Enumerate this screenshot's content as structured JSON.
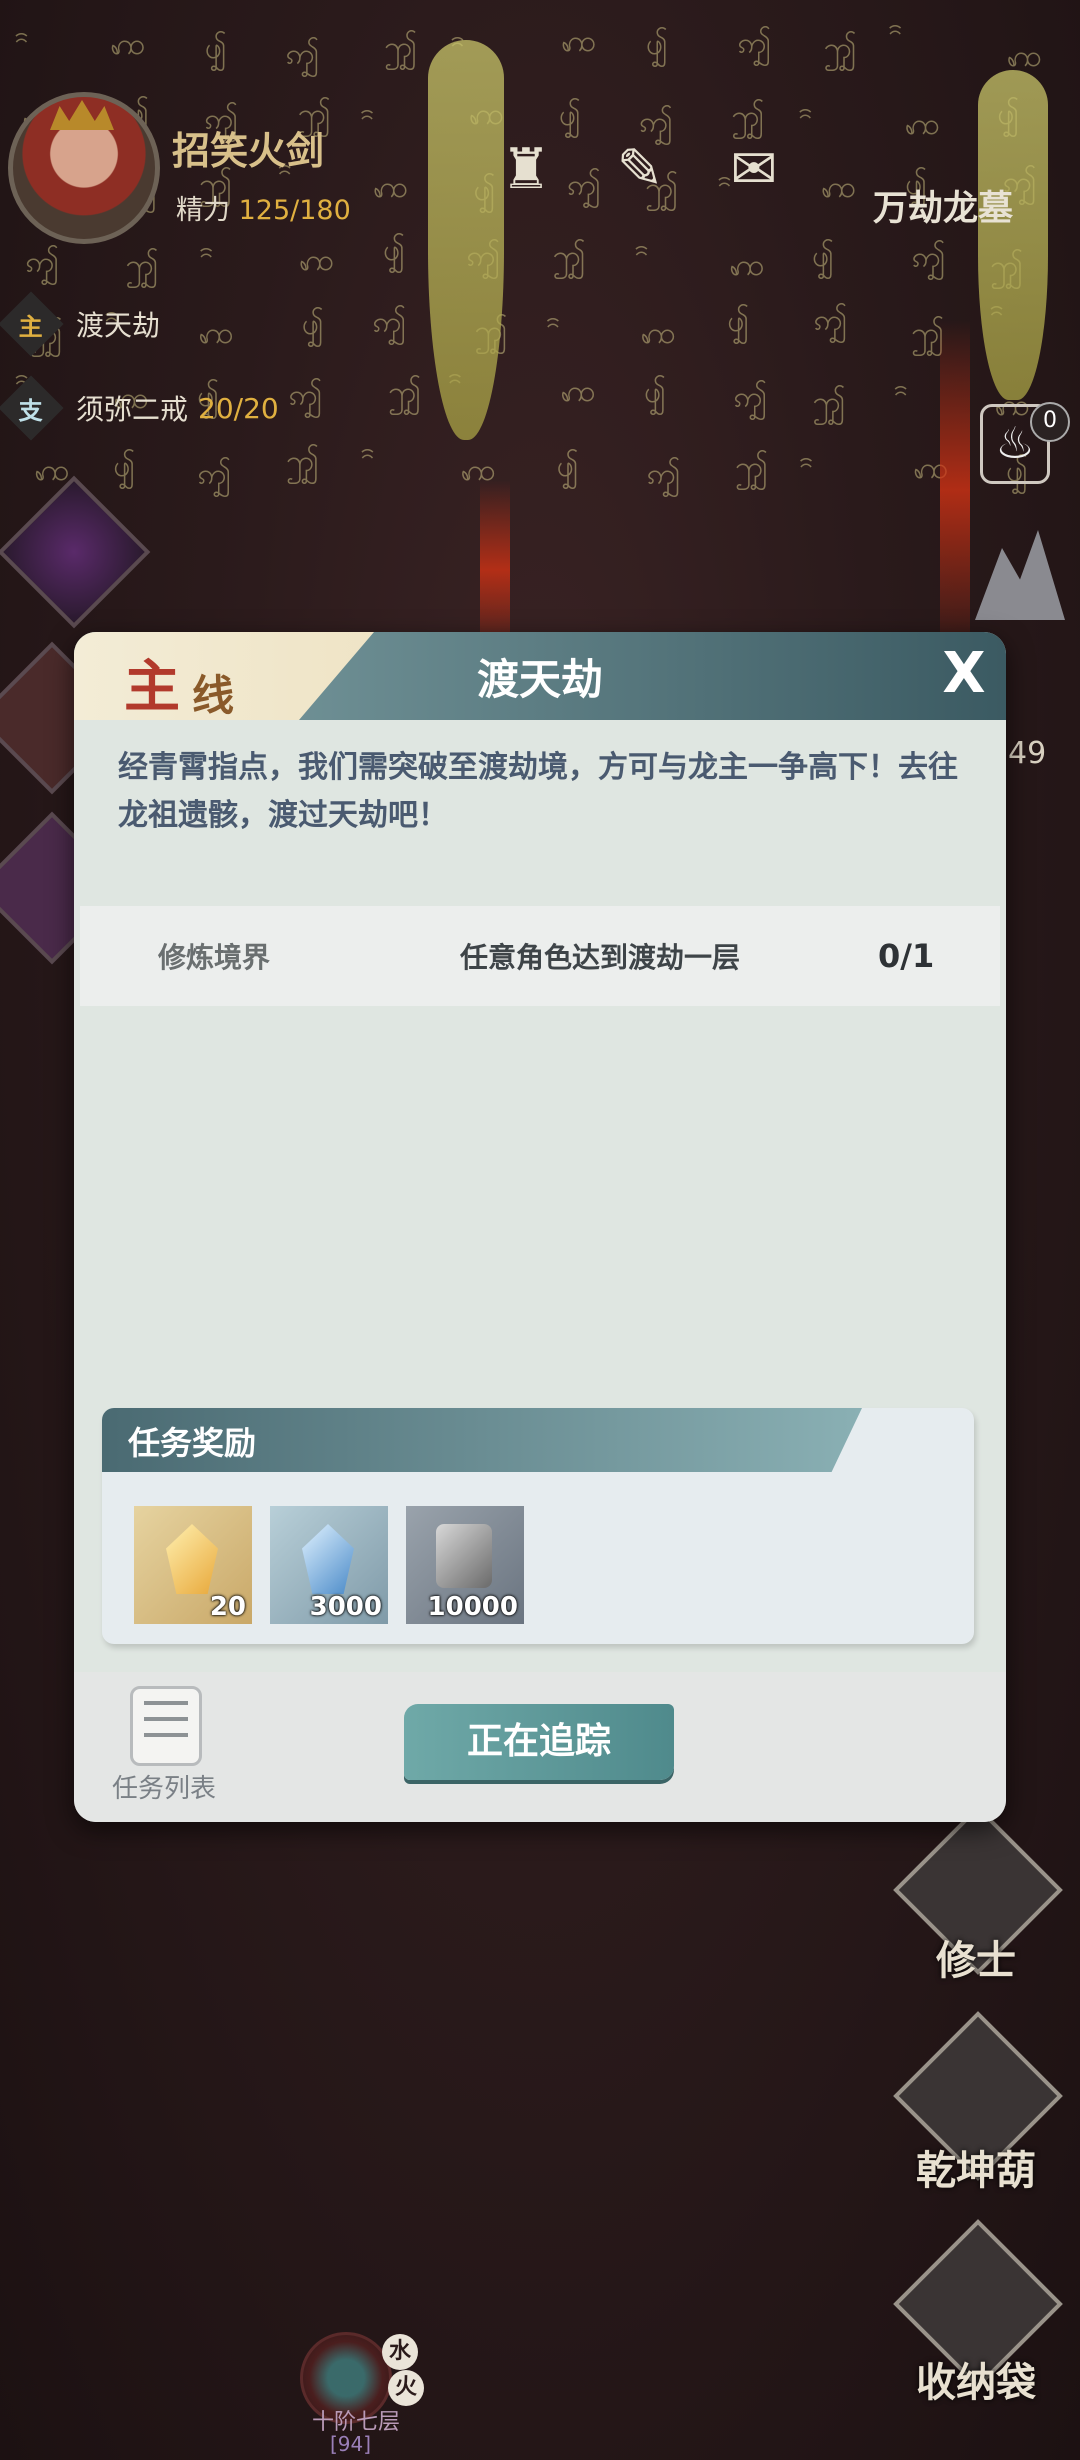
{
  "header": {
    "player_name": "招笑火剑",
    "energy_label": "精力",
    "energy_value": "125/180",
    "location": "万劫龙墓",
    "top_icons": [
      "bell-tower-icon",
      "scroll-map-icon",
      "scroll-bundle-icon"
    ]
  },
  "quests": [
    {
      "tag": "主",
      "name": "渡天劫",
      "progress": ""
    },
    {
      "tag": "支",
      "name": "须弥二戒",
      "progress": "20/20"
    }
  ],
  "right_side": {
    "badge_count": "0",
    "partial_number": "49",
    "buttons": [
      {
        "label": "修士",
        "icon": "cultivator-icon"
      },
      {
        "label": "乾坤葫",
        "icon": "gourd-icon"
      },
      {
        "label": "收纳袋",
        "icon": "storage-bag-icon"
      }
    ]
  },
  "dialog": {
    "tab_main": "主",
    "tab_line": "线",
    "title": "渡天劫",
    "close": "X",
    "description": "经青霄指点，我们需突破至渡劫境，方可与龙主一争高下！去往龙祖遗骸，渡过天劫吧！",
    "condition": {
      "category": "修炼境界",
      "requirement": "任意角色达到渡劫一层",
      "progress": "0/1"
    },
    "rewards_title": "任务奖励",
    "rewards": [
      {
        "icon": "gold-crystal-icon",
        "count": "20",
        "color": "#e8b84a"
      },
      {
        "icon": "blue-crystal-icon",
        "count": "3000",
        "color": "#8ab6d8"
      },
      {
        "icon": "scroll-icon",
        "count": "10000",
        "color": "#7a7f88"
      }
    ],
    "task_list_label": "任务列表",
    "track_button": "正在追踪"
  },
  "realm": {
    "name": "十阶七层",
    "level": "[94]",
    "elements": [
      "水",
      "火"
    ]
  }
}
